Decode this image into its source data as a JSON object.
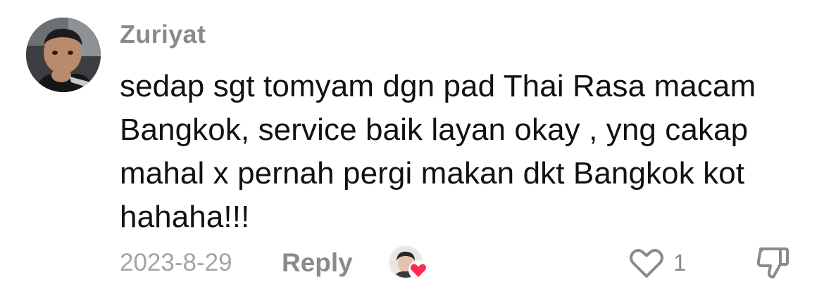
{
  "comment": {
    "author": "Zuriyat",
    "text": "sedap sgt tomyam dgn pad Thai Rasa macam Bangkok, service baik layan okay , yng cakap mahal x pernah pergi makan dkt Bangkok kot hahaha!!!",
    "date": "2023-8-29",
    "reply_label": "Reply",
    "like_count": "1",
    "liked_by_creator": true
  },
  "icons": {
    "like": "heart-outline-icon",
    "dislike": "thumbs-down-icon",
    "creator_liked": "heart-filled-icon"
  },
  "colors": {
    "text_primary": "#111111",
    "text_secondary": "#8a8a8a",
    "date": "#a4a4a4",
    "heart_accent": "#fe2c55"
  }
}
